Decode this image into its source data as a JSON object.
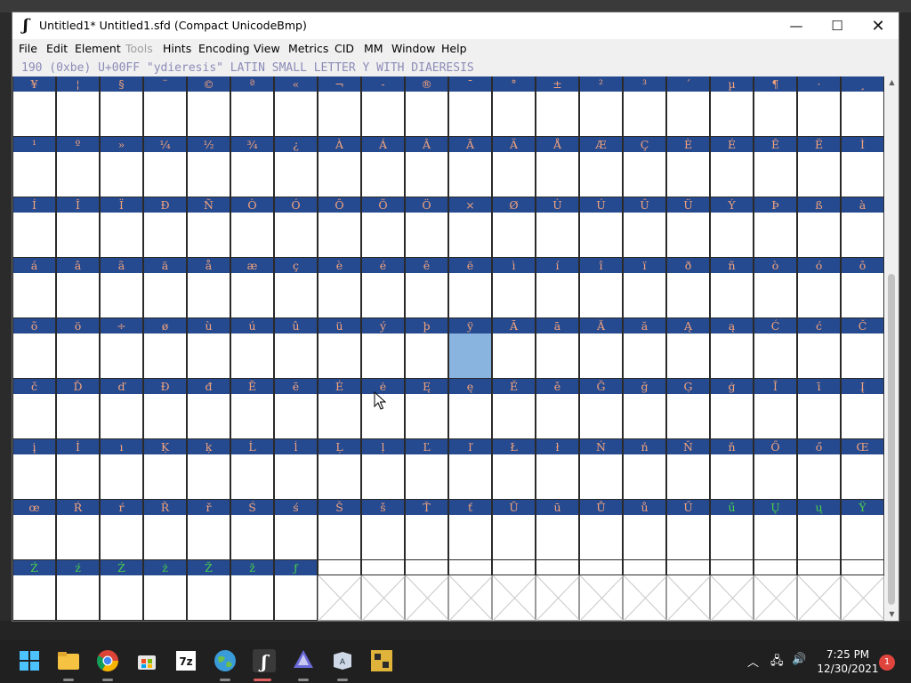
{
  "window": {
    "title": "Untitled1*  Untitled1.sfd (Compact UnicodeBmp)",
    "minimize_glyph": "—",
    "maximize_glyph": "☐",
    "close_glyph": "✕"
  },
  "menu": [
    {
      "label": "File",
      "disabled": false
    },
    {
      "label": "Edit",
      "disabled": false
    },
    {
      "label": "Element",
      "disabled": false
    },
    {
      "label": "Tools",
      "disabled": true
    },
    {
      "label": "Hints",
      "disabled": false
    },
    {
      "label": "Encoding",
      "disabled": false
    },
    {
      "label": "View",
      "disabled": false
    },
    {
      "label": "Metrics",
      "disabled": false
    },
    {
      "label": "CID",
      "disabled": false
    },
    {
      "label": "MM",
      "disabled": false
    },
    {
      "label": "Window",
      "disabled": false
    },
    {
      "label": "Help",
      "disabled": false
    }
  ],
  "status_line": "190 (0xbe) U+00FF \"ydieresis\" LATIN SMALL LETTER Y WITH DIAERESIS",
  "glyph_rows": [
    [
      "¥",
      "¦",
      "§",
      "¨",
      "©",
      "ª",
      "«",
      "¬",
      "-",
      "®",
      "¯",
      "°",
      "±",
      "²",
      "³",
      "´",
      "µ",
      "¶",
      "·",
      "¸"
    ],
    [
      "¹",
      "º",
      "»",
      "¼",
      "½",
      "¾",
      "¿",
      "À",
      "Á",
      "Â",
      "Ã",
      "Ä",
      "Å",
      "Æ",
      "Ç",
      "È",
      "É",
      "Ê",
      "Ë",
      "Ì"
    ],
    [
      "Í",
      "Î",
      "Ï",
      "Ð",
      "Ñ",
      "Ò",
      "Ó",
      "Ô",
      "Õ",
      "Ö",
      "×",
      "Ø",
      "Ù",
      "Ú",
      "Û",
      "Ü",
      "Ý",
      "Þ",
      "ß",
      "à"
    ],
    [
      "á",
      "â",
      "ã",
      "ä",
      "å",
      "æ",
      "ç",
      "è",
      "é",
      "ê",
      "ë",
      "ì",
      "í",
      "î",
      "ï",
      "ð",
      "ñ",
      "ò",
      "ó",
      "ô"
    ],
    [
      "õ",
      "ö",
      "÷",
      "ø",
      "ù",
      "ú",
      "û",
      "ü",
      "ý",
      "þ",
      "ÿ",
      "Ā",
      "ā",
      "Ă",
      "ă",
      "Ą",
      "ą",
      "Ć",
      "ć",
      "Č"
    ],
    [
      "č",
      "Ď",
      "ď",
      "Đ",
      "đ",
      "Ē",
      "ē",
      "Ė",
      "ė",
      "Ę",
      "ę",
      "Ě",
      "ě",
      "Ğ",
      "ğ",
      "Ģ",
      "ģ",
      "Ī",
      "ī",
      "Į"
    ],
    [
      "į",
      "İ",
      "ı",
      "Ķ",
      "ķ",
      "Ĺ",
      "ĺ",
      "Ļ",
      "ļ",
      "Ľ",
      "ľ",
      "Ł",
      "ł",
      "Ń",
      "ń",
      "Ň",
      "ň",
      "Ő",
      "ő",
      "Œ"
    ],
    [
      "œ",
      "Ŕ",
      "ŕ",
      "Ř",
      "ř",
      "Ś",
      "ś",
      "Š",
      "š",
      "Ť",
      "ť",
      "Ū",
      "ū",
      "Ů",
      "ů",
      "Ű",
      "ű",
      "Ų",
      "ų",
      "Ÿ"
    ],
    [
      "Ź",
      "ź",
      "Ż",
      "ż",
      "Ž",
      "ž",
      "ƒ",
      "",
      "",
      "",
      "",
      "",
      "",
      "",
      "",
      "",
      "",
      "",
      "",
      ""
    ]
  ],
  "green_glyphs": [
    "ű",
    "Ų",
    "ų",
    "Ÿ",
    "Ź",
    "ź",
    "Ż",
    "ż",
    "Ž",
    "ž",
    "ƒ"
  ],
  "selected_glyph": "ÿ",
  "label_color": "#f2a27c",
  "label_color_alt": "#49d04a",
  "label_bg": "#264a8f",
  "selection_color": "#8ab4e0",
  "taskbar": {
    "apps": [
      "start-icon",
      "file-explorer-icon",
      "chrome-icon",
      "store-icon",
      "7zip-icon",
      "browser-globe-icon",
      "fontforge-icon",
      "inkscape-icon",
      "app-icon",
      "puzzle-app-icon"
    ],
    "time": "7:25 PM",
    "date": "12/30/2021",
    "notification_count": "1"
  }
}
